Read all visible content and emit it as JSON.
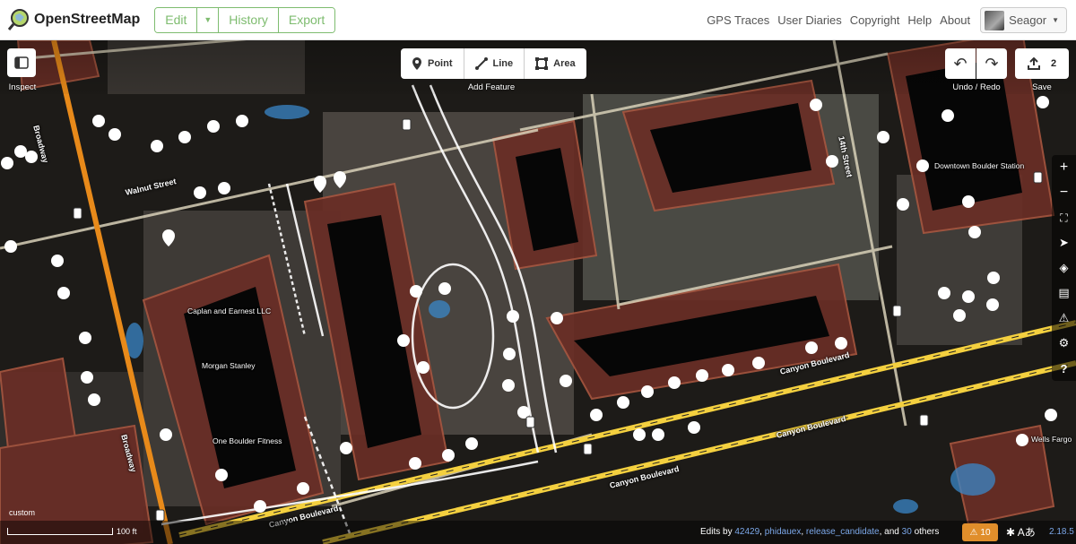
{
  "header": {
    "logo_text": "OpenStreetMap",
    "edit_label": "Edit",
    "history_label": "History",
    "export_label": "Export",
    "nav": [
      "GPS Traces",
      "User Diaries",
      "Copyright",
      "Help",
      "About"
    ],
    "username": "Seagor"
  },
  "toolbar": {
    "inspect_label": "Inspect",
    "point_label": "Point",
    "line_label": "Line",
    "area_label": "Area",
    "add_feature_label": "Add Feature",
    "undo_redo_label": "Undo / Redo",
    "save_label": "Save",
    "save_count": "2"
  },
  "streets": {
    "broadway": "Broadway",
    "walnut": "Walnut Street",
    "fourteenth": "14th Street",
    "canyon": "Canyon Boulevard"
  },
  "pois": {
    "caplan": "Caplan and Earnest LLC",
    "morgan": "Morgan Stanley",
    "fitness": "One Boulder Fitness",
    "station": "Downtown Boulder Station",
    "wells": "Wells Fargo"
  },
  "footer": {
    "imagery_label": "custom",
    "scale_label": "100 ft",
    "edits_prefix": "Edits by",
    "user1": "42429",
    "user2": "phidauex",
    "user3": "release_candidate",
    "and_label": ", and",
    "others_count": "30",
    "others_label": "others",
    "issues_count": "10",
    "version": "2.18.5"
  },
  "colors": {
    "accent_green": "#7ebc6f",
    "road_major": "#f4d03f",
    "road_arterial": "#e88a1a",
    "building_fill": "#5a2a22",
    "link_blue": "#7ba7e8",
    "issues_orange": "#e08e2b"
  }
}
